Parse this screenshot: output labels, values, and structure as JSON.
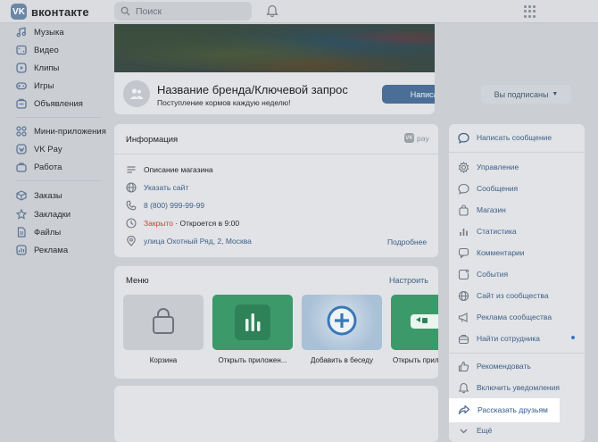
{
  "header": {
    "logo_mark": "VK",
    "logo_text": "вконтакте",
    "search_placeholder": "Поиск"
  },
  "leftnav": {
    "items": [
      {
        "label": "Музыка",
        "icon": "music-icon"
      },
      {
        "label": "Видео",
        "icon": "video-icon"
      },
      {
        "label": "Клипы",
        "icon": "clips-icon"
      },
      {
        "label": "Игры",
        "icon": "games-icon"
      },
      {
        "label": "Объявления",
        "icon": "ads-icon"
      },
      {
        "label": "Мини-приложения",
        "icon": "mini-apps-icon"
      },
      {
        "label": "VK Pay",
        "icon": "vkpay-icon"
      },
      {
        "label": "Работа",
        "icon": "work-icon"
      },
      {
        "label": "Заказы",
        "icon": "orders-icon"
      },
      {
        "label": "Закладки",
        "icon": "bookmarks-icon"
      },
      {
        "label": "Файлы",
        "icon": "files-icon"
      },
      {
        "label": "Реклама",
        "icon": "advertising-icon"
      }
    ]
  },
  "brand": {
    "title": "Название бренда/Ключевой запрос",
    "status": "Поступление кормов каждую неделю!",
    "write_button": "Написать",
    "subscribed_button": "Вы подписаны"
  },
  "info": {
    "title": "Информация",
    "vkpay_badge": "pay",
    "rows": [
      {
        "text": "Описание магазина",
        "icon": "list-icon"
      },
      {
        "text": "Указать сайт",
        "icon": "globe-icon"
      },
      {
        "text": "8 (800) 999-99-99",
        "icon": "phone-icon"
      },
      {
        "closed": "Закрыто",
        "opens": " · Откроется в 9:00",
        "icon": "clock-icon"
      },
      {
        "text": "улица Охотный Ряд, 2, Москва",
        "icon": "location-icon"
      }
    ],
    "more": "Подробнее"
  },
  "menu": {
    "title": "Меню",
    "setup": "Настроить",
    "tiles": [
      {
        "label": "Корзина"
      },
      {
        "label": "Открыть приложен..."
      },
      {
        "label": "Добавить в беседу"
      },
      {
        "label": "Открыть прил"
      }
    ]
  },
  "right": {
    "top_item": "Написать сообщение",
    "items": [
      "Управление",
      "Сообщения",
      "Магазин",
      "Статистика",
      "Комментарии",
      "События",
      "Сайт из сообщества",
      "Реклама сообщества",
      "Найти сотрудника"
    ],
    "bottom_items": [
      "Рекомендовать",
      "Включить уведомления",
      "Рассказать друзьям",
      "Ещё"
    ]
  },
  "colors": {
    "accent": "#4a6e96",
    "link": "#3d5f87",
    "closed_red": "#c2463c"
  }
}
